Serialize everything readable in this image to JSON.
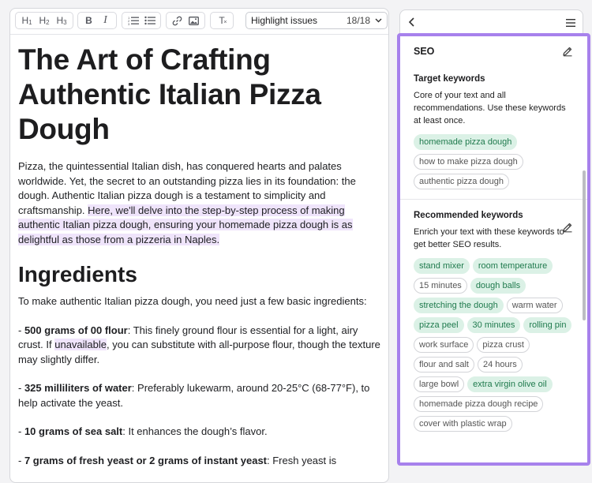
{
  "toolbar": {
    "h1": "H",
    "h1sub": "1",
    "h2": "H",
    "h2sub": "2",
    "h3": "H",
    "h3sub": "3",
    "bold": "B",
    "italic": "I",
    "clear": "T",
    "highlight_label": "Highlight issues",
    "highlight_count": "18/18"
  },
  "article": {
    "title": "The Art of Crafting Authentic Italian Pizza Dough",
    "intro_plain": "Pizza, the quintessential Italian dish, has conquered hearts and palates worldwide. Yet, the secret to an outstanding pizza lies in its foundation: the dough. Authentic Italian pizza dough is a testament to simplicity and craftsmanship. ",
    "intro_highlight": "Here, we'll delve into the step-by-step process of making authentic Italian pizza dough, ensuring your homemade pizza dough is as delightful as those from a pizzeria in Naples.",
    "ingredients_heading": "Ingredients",
    "ingredients_intro": "To make authentic Italian pizza dough, you need just a few basic ingredients:",
    "items": [
      {
        "bold": "500 grams of 00 flour",
        "text1": ": This finely ground flour is essential for a light, airy crust. If ",
        "hl": "unavailable",
        "text2": ", you can substitute with all-purpose flour, though the texture may slightly differ."
      },
      {
        "bold": "325 milliliters of water",
        "text1": ": Preferably lukewarm, around 20-25°C (68-77°F), to help activate the yeast."
      },
      {
        "bold": "10 grams of sea salt",
        "text1": ": It enhances the dough’s flavor."
      },
      {
        "bold": "7 grams of fresh yeast or 2 grams of instant yeast",
        "text1": ": Fresh yeast is"
      }
    ],
    "dash": "- "
  },
  "panel": {
    "seo_title": "SEO",
    "target_title": "Target keywords",
    "target_desc": "Core of your text and all recommendations. Use these keywords at least once.",
    "target_keywords": [
      {
        "label": "homemade pizza dough",
        "used": true
      },
      {
        "label": "how to make pizza dough",
        "used": false
      },
      {
        "label": "authentic pizza dough",
        "used": false
      }
    ],
    "recommended_title": "Recommended keywords",
    "recommended_desc": "Enrich your text with these keywords to get better SEO results.",
    "recommended_keywords": [
      {
        "label": "stand mixer",
        "used": true
      },
      {
        "label": "room temperature",
        "used": true
      },
      {
        "label": "15 minutes",
        "used": false
      },
      {
        "label": "dough balls",
        "used": true
      },
      {
        "label": "stretching the dough",
        "used": true
      },
      {
        "label": "warm water",
        "used": false
      },
      {
        "label": "pizza peel",
        "used": true
      },
      {
        "label": "30 minutes",
        "used": true
      },
      {
        "label": "rolling pin",
        "used": true
      },
      {
        "label": "work surface",
        "used": false
      },
      {
        "label": "pizza crust",
        "used": false
      },
      {
        "label": "flour and salt",
        "used": false
      },
      {
        "label": "24 hours",
        "used": false
      },
      {
        "label": "large bowl",
        "used": false
      },
      {
        "label": "extra virgin olive oil",
        "used": true
      },
      {
        "label": "homemade pizza dough recipe",
        "used": false
      },
      {
        "label": "cover with plastic wrap",
        "used": false
      }
    ]
  },
  "colors": {
    "panel_border": "#a781ec",
    "highlight": "#efe4fb",
    "chip_used_bg": "#dbf1e6",
    "chip_used_text": "#1f7a4d"
  }
}
